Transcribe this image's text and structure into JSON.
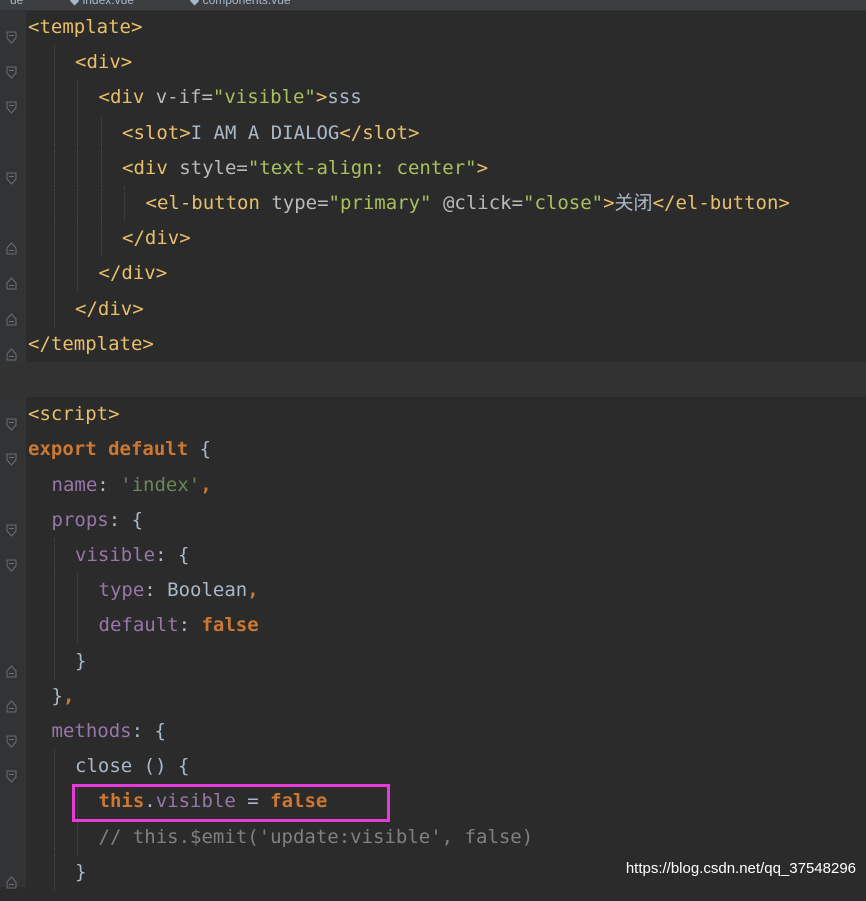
{
  "tabs": [
    {
      "label": "ue",
      "active": true
    },
    {
      "label": "◆ index.vue",
      "active": false
    },
    {
      "label": "◆ components.vue",
      "active": false
    }
  ],
  "lines": [
    {
      "indent": 0,
      "fold": "open",
      "tokens": [
        {
          "t": "tag",
          "v": "<template>"
        }
      ]
    },
    {
      "indent": 2,
      "fold": "open",
      "tokens": [
        {
          "t": "tag",
          "v": "<div>"
        }
      ]
    },
    {
      "indent": 3,
      "fold": "open",
      "tokens": [
        {
          "t": "tag",
          "v": "<div "
        },
        {
          "t": "attr",
          "v": "v-if="
        },
        {
          "t": "str",
          "v": "\"visible\""
        },
        {
          "t": "tag",
          "v": ">"
        },
        {
          "t": "text",
          "v": "sss"
        }
      ]
    },
    {
      "indent": 4,
      "fold": "none",
      "tokens": [
        {
          "t": "tag",
          "v": "<slot>"
        },
        {
          "t": "text",
          "v": "I AM A DIALOG"
        },
        {
          "t": "tag",
          "v": "</slot>"
        }
      ]
    },
    {
      "indent": 4,
      "fold": "open",
      "tokens": [
        {
          "t": "tag",
          "v": "<div "
        },
        {
          "t": "attr",
          "v": "style="
        },
        {
          "t": "str",
          "v": "\"text-align: center\""
        },
        {
          "t": "tag",
          "v": ">"
        }
      ]
    },
    {
      "indent": 5,
      "fold": "none",
      "tokens": [
        {
          "t": "tag",
          "v": "<el-button "
        },
        {
          "t": "attr",
          "v": "type="
        },
        {
          "t": "str",
          "v": "\"primary\" "
        },
        {
          "t": "attr",
          "v": "@click="
        },
        {
          "t": "str",
          "v": "\"close\""
        },
        {
          "t": "tag",
          "v": ">"
        },
        {
          "t": "text",
          "v": "关闭"
        },
        {
          "t": "tag",
          "v": "</el-button>"
        }
      ]
    },
    {
      "indent": 4,
      "fold": "close",
      "tokens": [
        {
          "t": "tag",
          "v": "</div>"
        }
      ]
    },
    {
      "indent": 3,
      "fold": "close",
      "tokens": [
        {
          "t": "tag",
          "v": "</div>"
        }
      ]
    },
    {
      "indent": 2,
      "fold": "close",
      "tokens": [
        {
          "t": "tag",
          "v": "</div>"
        }
      ]
    },
    {
      "indent": 0,
      "fold": "close",
      "tokens": [
        {
          "t": "tag",
          "v": "</template>"
        }
      ]
    },
    {
      "indent": 0,
      "fold": "none",
      "current": true,
      "tokens": []
    },
    {
      "indent": 0,
      "fold": "open",
      "tokens": [
        {
          "t": "tag",
          "v": "<script>"
        }
      ]
    },
    {
      "indent": 0,
      "fold": "open",
      "tokens": [
        {
          "t": "kw",
          "v": "export default "
        },
        {
          "t": "plain",
          "v": "{"
        }
      ]
    },
    {
      "indent": 1,
      "fold": "none",
      "tokens": [
        {
          "t": "prop",
          "v": "name"
        },
        {
          "t": "plain",
          "v": ": "
        },
        {
          "t": "strq",
          "v": "'index'"
        },
        {
          "t": "kw",
          "v": ","
        }
      ]
    },
    {
      "indent": 1,
      "fold": "open",
      "tokens": [
        {
          "t": "prop",
          "v": "props"
        },
        {
          "t": "plain",
          "v": ": {"
        }
      ]
    },
    {
      "indent": 2,
      "fold": "open",
      "tokens": [
        {
          "t": "prop",
          "v": "visible"
        },
        {
          "t": "plain",
          "v": ": {"
        }
      ]
    },
    {
      "indent": 3,
      "fold": "none",
      "tokens": [
        {
          "t": "prop",
          "v": "type"
        },
        {
          "t": "plain",
          "v": ": Boolean"
        },
        {
          "t": "kw",
          "v": ","
        }
      ]
    },
    {
      "indent": 3,
      "fold": "none",
      "tokens": [
        {
          "t": "prop",
          "v": "default"
        },
        {
          "t": "plain",
          "v": ": "
        },
        {
          "t": "kw",
          "v": "false"
        }
      ]
    },
    {
      "indent": 2,
      "fold": "close",
      "tokens": [
        {
          "t": "plain",
          "v": "}"
        }
      ]
    },
    {
      "indent": 1,
      "fold": "close",
      "tokens": [
        {
          "t": "plain",
          "v": "}"
        },
        {
          "t": "kw",
          "v": ","
        }
      ]
    },
    {
      "indent": 1,
      "fold": "open",
      "tokens": [
        {
          "t": "prop",
          "v": "methods"
        },
        {
          "t": "plain",
          "v": ": {"
        }
      ]
    },
    {
      "indent": 2,
      "fold": "open",
      "tokens": [
        {
          "t": "plain",
          "v": "close () {"
        }
      ]
    },
    {
      "indent": 3,
      "fold": "none",
      "tokens": [
        {
          "t": "kw",
          "v": "this"
        },
        {
          "t": "plain",
          "v": "."
        },
        {
          "t": "prop",
          "v": "visible"
        },
        {
          "t": "plain",
          "v": " = "
        },
        {
          "t": "kw",
          "v": "false"
        }
      ]
    },
    {
      "indent": 3,
      "fold": "none",
      "tokens": [
        {
          "t": "cmt",
          "v": "// this.$emit('update:visible', false)"
        }
      ]
    },
    {
      "indent": 2,
      "fold": "close",
      "tokens": [
        {
          "t": "plain",
          "v": "}"
        }
      ]
    }
  ],
  "watermark": "https://blog.csdn.net/qq_37548296",
  "colors": {
    "background": "#2b2b2b",
    "gutter": "#313335",
    "highlight_box": "#e63bd8",
    "current_line": "#323232"
  }
}
